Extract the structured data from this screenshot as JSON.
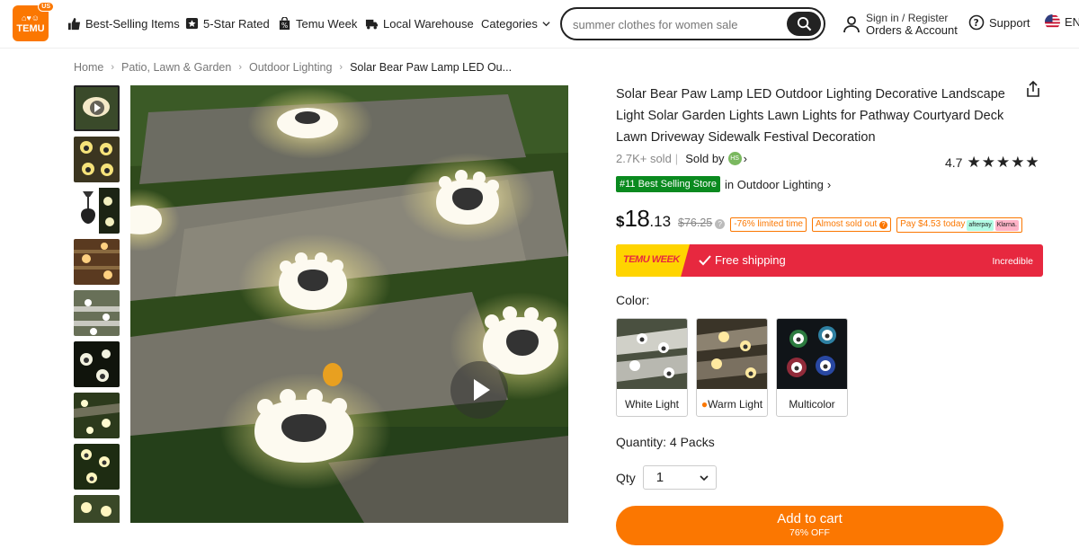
{
  "header": {
    "logo": {
      "text": "TEMU",
      "region_badge": "US",
      "icons": "⌂♥☺"
    },
    "nav": [
      {
        "label": "Best-Selling Items",
        "icon": "thumbs-up-icon"
      },
      {
        "label": "5-Star Rated",
        "icon": "star-badge-icon"
      },
      {
        "label": "Temu Week",
        "icon": "percent-bag-icon"
      },
      {
        "label": "Local Warehouse",
        "icon": "truck-icon"
      },
      {
        "label": "Categories",
        "icon": "chevron-down-icon"
      }
    ],
    "search": {
      "value": "summer clothes for women sale",
      "icon": "search-icon"
    },
    "account": {
      "line1": "Sign in / Register",
      "line2": "Orders & Account",
      "icon": "user-icon"
    },
    "support": {
      "label": "Support",
      "icon": "question-circle-icon"
    },
    "language": {
      "label": "EN",
      "icon": "us-flag-icon"
    }
  },
  "breadcrumb": [
    "Home",
    "Patio, Lawn & Garden",
    "Outdoor Lighting",
    "Solar Bear Paw Lamp LED Ou..."
  ],
  "gallery": {
    "thumbnail_count": 9,
    "active_index": 0,
    "play_icon": "play-icon"
  },
  "product": {
    "title": "Solar Bear Paw Lamp LED Outdoor Lighting Decorative Landscape Light Solar Garden Lights Lawn Lights for Pathway Courtyard Deck Lawn Driveway Sidewalk Festival Decoration",
    "sold_count": "2.7K+ sold",
    "sold_by": "Sold by",
    "store_badge": "HS",
    "rating": "4.7",
    "stars": "★★★★★",
    "bestseller_tag": "#11 Best Selling Store",
    "bestseller_category": "in Outdoor Lighting",
    "price": {
      "currency": "$",
      "dollars": "18",
      "cents": ".13",
      "old": "$76.25"
    },
    "chips": [
      "-76% limited time",
      "Almost sold out",
      "Pay $4.53 today"
    ],
    "pay_logos": [
      "afterpay",
      "Klarna."
    ],
    "promo": {
      "brand": "TEMU WEEK",
      "shipping": "Free shipping",
      "tagline": "Incredible"
    },
    "color_label": "Color:",
    "colors": [
      {
        "label": "White Light",
        "selected": false
      },
      {
        "label": "Warm Light",
        "selected": false,
        "icon": "flame-icon"
      },
      {
        "label": "Multicolor",
        "selected": false
      }
    ],
    "quantity_text": "Quantity: 4 Packs",
    "qty_label": "Qty",
    "qty_value": "1",
    "add_to_cart": {
      "label": "Add to cart",
      "sub": "76% OFF"
    }
  },
  "colors": {
    "brand_orange": "#fb7701",
    "promo_red": "#e7283f",
    "promo_yellow": "#ffd400",
    "bestseller_green": "#0a8a1f"
  }
}
